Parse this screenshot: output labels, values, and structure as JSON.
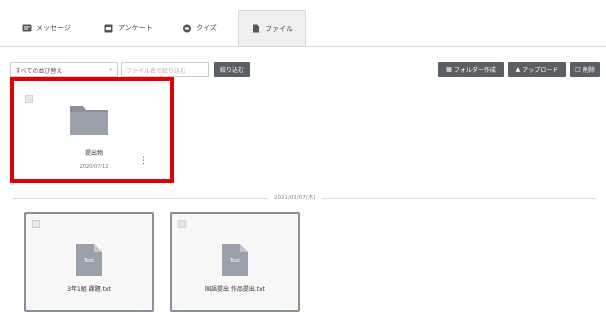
{
  "tabs": [
    {
      "label": "メッセージ",
      "icon": "message-icon",
      "active": false
    },
    {
      "label": "アンケート",
      "icon": "survey-icon",
      "active": false
    },
    {
      "label": "クイズ",
      "icon": "quiz-icon",
      "active": false
    },
    {
      "label": "ファイル",
      "icon": "file-icon",
      "active": true
    }
  ],
  "toolbar": {
    "sort_value": "すべての並び替え",
    "search_placeholder": "ファイル名で絞り込む",
    "filter_button": "絞り込む",
    "new_folder_button": "フォルダー作成",
    "upload_button": "アップロード",
    "delete_button": "削除"
  },
  "folder": {
    "name": "提出物",
    "date": "2020/07/12"
  },
  "date_divider": "2021/01/07(木)",
  "files": [
    {
      "name": "3年1組 課題.txt",
      "type_label": "Text"
    },
    {
      "name": "国語提出 作品提出.txt",
      "type_label": "Text"
    }
  ],
  "colors": {
    "highlight": "#e00000",
    "button_dark": "#5a5f66"
  }
}
